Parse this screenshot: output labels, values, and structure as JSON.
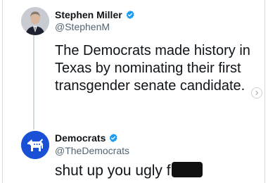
{
  "tweet": {
    "author_name": "Stephen Miller",
    "author_handle": "@StephenM",
    "text": "The Democrats made history in Texas by nominating their first transgender senate candidate."
  },
  "reply": {
    "author_name": "Democrats",
    "author_handle": "@TheDemocrats",
    "text": "shut up you ugly f"
  },
  "icons": {
    "verified": "verified-badge-icon",
    "next": "chevron-right-icon",
    "democrats_logo": "donkey-logo-icon"
  },
  "colors": {
    "verified_blue": "#1d9bf0",
    "democrats_blue": "#1a50d6",
    "handle_gray": "#536471"
  }
}
